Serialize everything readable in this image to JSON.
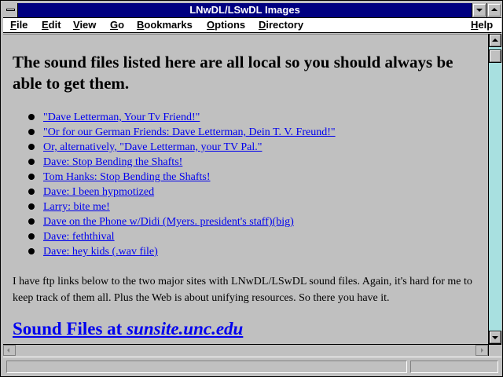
{
  "window": {
    "title": "LNwDL/LSwDL Images"
  },
  "menubar": {
    "items": [
      {
        "label": "File",
        "mnemonic": "F"
      },
      {
        "label": "Edit",
        "mnemonic": "E"
      },
      {
        "label": "View",
        "mnemonic": "V"
      },
      {
        "label": "Go",
        "mnemonic": "G"
      },
      {
        "label": "Bookmarks",
        "mnemonic": "B"
      },
      {
        "label": "Options",
        "mnemonic": "O"
      },
      {
        "label": "Directory",
        "mnemonic": "D"
      },
      {
        "label": "Help",
        "mnemonic": "H"
      }
    ]
  },
  "page": {
    "heading": "The sound files listed here are all local so you should always be able to get them.",
    "links": [
      "\"Dave Letterman, Your Tv Friend!\"",
      "\"Or for our German Friends: Dave Letterman, Dein T. V. Freund!\"",
      "Or, alternatively, \"Dave Letterman, your TV Pal.\"",
      "Dave: Stop Bending the Shafts!",
      "Tom Hanks: Stop Bending the Shafts!",
      "Dave: I been hypmotized",
      "Larry: bite me!",
      "Dave on the Phone w/Didi (Myers. president's staff)(big)",
      "Dave: feththival",
      "Dave: hey kids (.wav file)"
    ],
    "paragraph": "I have ftp links below to the two major sites with LNwDL/LSwDL sound files. Again, it's hard for me to keep track of them all. Plus the Web is about unifying resources. So there you have it.",
    "section_link_prefix": "Sound Files at ",
    "section_link_site": "sunsite.unc.edu"
  },
  "statusbar": {
    "text": ""
  },
  "colors": {
    "title_bar": "#000080",
    "link": "#0000ee",
    "background": "#c0c0c0",
    "scroll_track": "#a8e0e0"
  },
  "icons": {
    "system_menu": "system-menu-icon",
    "minimize": "minimize-icon",
    "maximize": "maximize-icon",
    "bullet": "bullet-icon"
  }
}
